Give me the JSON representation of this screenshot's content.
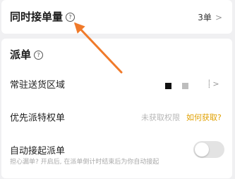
{
  "order_limit": {
    "title": "同时接单量",
    "help_glyph": "?",
    "value": "3单",
    "chevron": ">"
  },
  "dispatch": {
    "title": "派单",
    "help_glyph": "?",
    "rows": [
      {
        "label": "常驻送货区域",
        "chevron": "⸽ >"
      },
      {
        "label": "优先派特权单",
        "status": "未获取权限",
        "link": "如何获取?"
      },
      {
        "label": "自动接起派单",
        "sublabel": "担心漏单? 开启后, 在派单倒计时结束后为你自动接起",
        "toggle_on": false
      }
    ]
  },
  "annotation": {
    "arrow_color": "#f07a2a",
    "icon": "arrow-pointer"
  }
}
